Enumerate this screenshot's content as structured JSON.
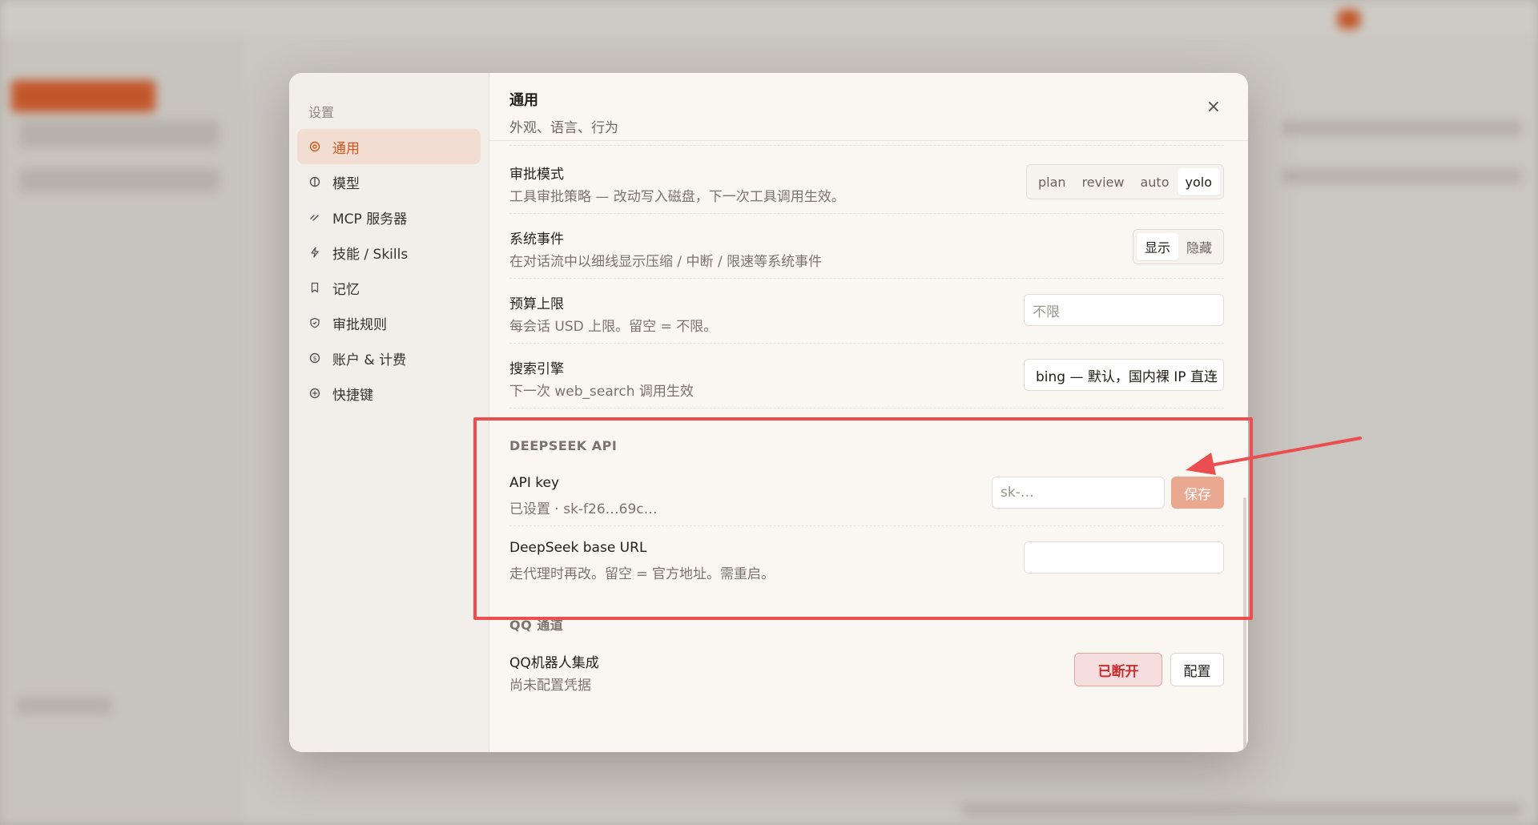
{
  "settings_nav": {
    "heading": "设置",
    "items": [
      {
        "label": "通用",
        "icon": "general-icon",
        "active": true
      },
      {
        "label": "模型",
        "icon": "model-icon"
      },
      {
        "label": "MCP 服务器",
        "icon": "mcp-icon"
      },
      {
        "label": "技能 / Skills",
        "icon": "skills-icon"
      },
      {
        "label": "记忆",
        "icon": "memory-icon"
      },
      {
        "label": "审批规则",
        "icon": "approval-rules-icon"
      },
      {
        "label": "账户 & 计费",
        "icon": "billing-icon"
      },
      {
        "label": "快捷键",
        "icon": "shortcuts-icon"
      }
    ]
  },
  "panel": {
    "title": "通用",
    "subtitle": "外观、语言、行为"
  },
  "approval_mode": {
    "label": "审批模式",
    "description": "工具审批策略 — 改动写入磁盘，下一次工具调用生效。",
    "options": [
      "plan",
      "review",
      "auto",
      "yolo"
    ],
    "selected": "yolo"
  },
  "system_events": {
    "label": "系统事件",
    "description": "在对话流中以细线显示压缩 / 中断 / 限速等系统事件",
    "options": [
      "显示",
      "隐藏"
    ],
    "selected": "显示"
  },
  "budget_limit": {
    "label": "预算上限",
    "description": "每会话 USD 上限。留空 = 不限。",
    "placeholder": "不限"
  },
  "search_engine": {
    "label": "搜索引擎",
    "description": "下一次 web_search 调用生效",
    "value": "bing — 默认，国内裸 IP 直连"
  },
  "deepseek_section": {
    "heading": "DEEPSEEK API",
    "api_key": {
      "label": "API key",
      "description": "已设置 · sk-f26…69c…",
      "placeholder": "sk-…",
      "save_label": "保存"
    },
    "base_url": {
      "label": "DeepSeek base URL",
      "description": "走代理时再改。留空 = 官方地址。需重启。",
      "value": ""
    }
  },
  "qq_section": {
    "heading": "QQ 通道",
    "bot": {
      "label": "QQ机器人集成",
      "description": "尚未配置凭据",
      "status_label": "已断开",
      "config_label": "配置"
    }
  },
  "colors": {
    "accent": "#d2561d",
    "highlight_annotation": "#ea4e50",
    "disconnected": "#c42f2f"
  }
}
